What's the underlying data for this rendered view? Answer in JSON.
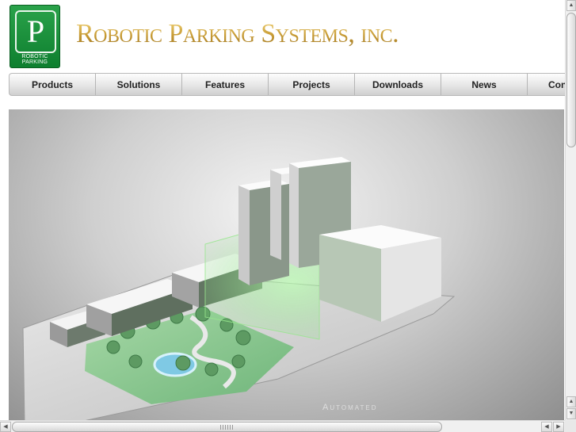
{
  "header": {
    "logo_letter": "P",
    "logo_caption": "ROBOTIC PARKING",
    "brand_title": "Robotic Parking Systems, inc."
  },
  "nav": {
    "items": [
      {
        "label": "Products"
      },
      {
        "label": "Solutions"
      },
      {
        "label": "Features"
      },
      {
        "label": "Projects"
      },
      {
        "label": "Downloads"
      },
      {
        "label": "News"
      },
      {
        "label": "Con"
      }
    ]
  },
  "hero": {
    "caption": "Automated"
  },
  "colors": {
    "logo_green": "#1a8f3c",
    "brand_gold": "#c69a34",
    "glass_green": "#7fe07a"
  }
}
